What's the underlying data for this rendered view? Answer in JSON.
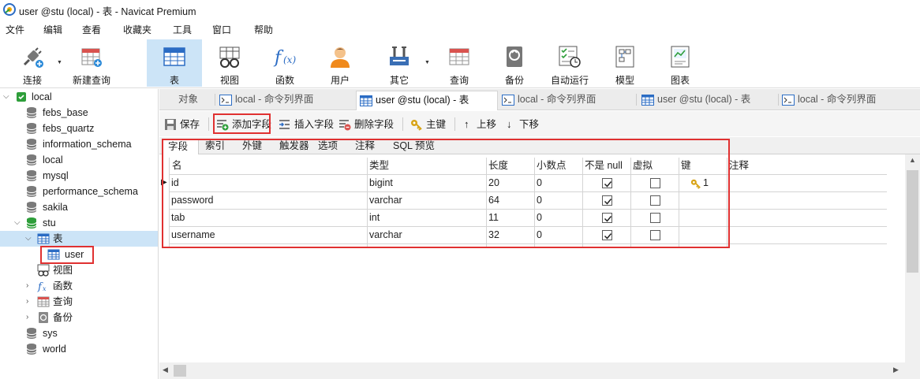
{
  "window": {
    "title": "user @stu (local) - 表 - Navicat Premium"
  },
  "menu": [
    "文件",
    "编辑",
    "查看",
    "收藏夹",
    "工具",
    "窗口",
    "帮助"
  ],
  "toolbar": [
    {
      "label": "连接",
      "icon": "connection-icon"
    },
    {
      "label": "新建查询",
      "icon": "new-query-icon"
    },
    {
      "label": "表",
      "icon": "table-icon",
      "active": true
    },
    {
      "label": "视图",
      "icon": "view-icon"
    },
    {
      "label": "函数",
      "icon": "function-icon"
    },
    {
      "label": "用户",
      "icon": "user-icon"
    },
    {
      "label": "其它",
      "icon": "other-tools-icon"
    },
    {
      "label": "查询",
      "icon": "query-icon"
    },
    {
      "label": "备份",
      "icon": "backup-icon"
    },
    {
      "label": "自动运行",
      "icon": "automation-icon"
    },
    {
      "label": "模型",
      "icon": "model-icon"
    },
    {
      "label": "图表",
      "icon": "chart-icon"
    }
  ],
  "sidebar": {
    "root": "local",
    "databases": [
      "febs_base",
      "febs_quartz",
      "information_schema",
      "local",
      "mysql",
      "performance_schema",
      "sakila",
      "stu"
    ],
    "stu_children": {
      "tables": "表",
      "table_user": "user",
      "views": "视图",
      "functions": "函数",
      "queries": "查询",
      "backups": "备份"
    },
    "after": [
      "sys",
      "world"
    ]
  },
  "tabs": [
    {
      "label": "对象"
    },
    {
      "label": "local - 命令列界面"
    },
    {
      "label": "user @stu (local) - 表",
      "active": true
    },
    {
      "label": "local - 命令列界面"
    },
    {
      "label": "user @stu (local) - 表"
    },
    {
      "label": "local - 命令列界面"
    }
  ],
  "edit_toolbar": {
    "save": "保存",
    "add_field": "添加字段",
    "insert_field": "插入字段",
    "delete_field": "删除字段",
    "primary_key": "主键",
    "move_up": "上移",
    "move_down": "下移"
  },
  "subtabs": [
    "字段",
    "索引",
    "外键",
    "触发器",
    "选项",
    "注释",
    "SQL 预览"
  ],
  "columns": [
    "名",
    "类型",
    "长度",
    "小数点",
    "不是 null",
    "虚拟",
    "键",
    "注释"
  ],
  "fields": [
    {
      "name": "id",
      "type": "bigint",
      "length": "20",
      "decimals": "0",
      "not_null": true,
      "virtual": false,
      "key": "1"
    },
    {
      "name": "password",
      "type": "varchar",
      "length": "64",
      "decimals": "0",
      "not_null": true,
      "virtual": false,
      "key": ""
    },
    {
      "name": "tab",
      "type": "int",
      "length": "11",
      "decimals": "0",
      "not_null": true,
      "virtual": false,
      "key": ""
    },
    {
      "name": "username",
      "type": "varchar",
      "length": "32",
      "decimals": "0",
      "not_null": true,
      "virtual": false,
      "key": ""
    }
  ],
  "colors": {
    "highlight_red": "#e03131",
    "selection": "#cce4f7",
    "db_green": "#2e9e3a",
    "key_gold": "#d8a316"
  }
}
